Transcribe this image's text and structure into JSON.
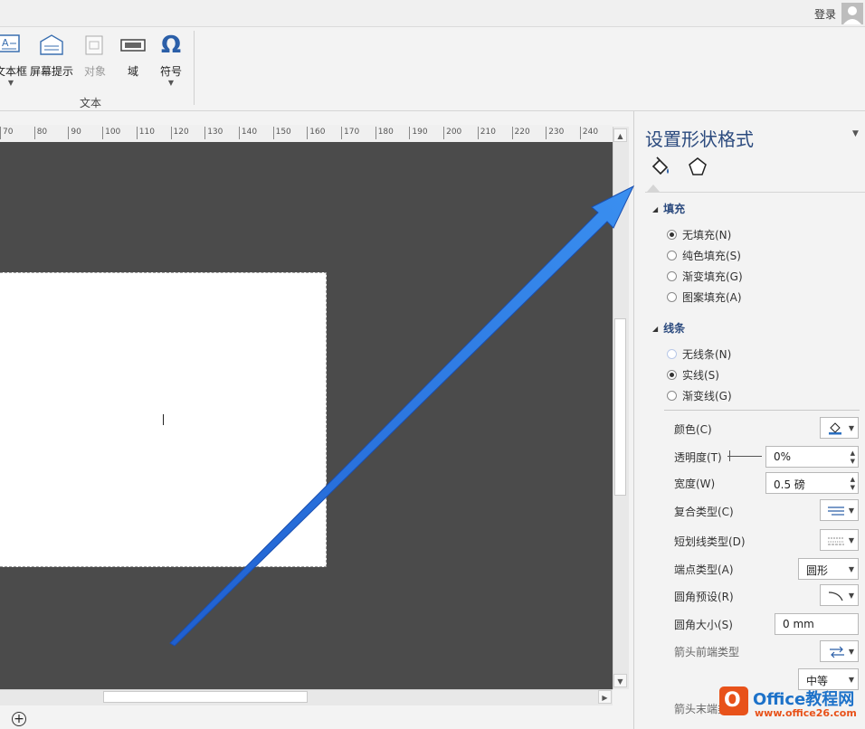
{
  "header": {
    "login_label": "登录"
  },
  "ribbon": {
    "buttons": [
      {
        "label": "文本框"
      },
      {
        "label": "屏幕提示"
      },
      {
        "label": "对象"
      },
      {
        "label": "域"
      },
      {
        "label": "符号",
        "glyph": "Ω"
      }
    ],
    "group_label": "文本"
  },
  "ruler": {
    "ticks": [
      "70",
      "80",
      "90",
      "100",
      "110",
      "120",
      "130",
      "140",
      "150",
      "160",
      "170",
      "180",
      "190",
      "200",
      "210",
      "220",
      "230",
      "240"
    ]
  },
  "panel": {
    "title": "设置形状格式",
    "fill_section": {
      "title": "填充",
      "options": [
        "无填充(N)",
        "纯色填充(S)",
        "渐变填充(G)",
        "图案填充(A)"
      ],
      "selected": 0
    },
    "line_section": {
      "title": "线条",
      "options": [
        "无线条(N)",
        "实线(S)",
        "渐变线(G)"
      ],
      "selected": 1
    },
    "properties": {
      "color_label": "颜色(C)",
      "transparency_label": "透明度(T)",
      "transparency_value": "0%",
      "width_label": "宽度(W)",
      "width_value": "0.5 磅",
      "compound_label": "复合类型(C)",
      "dash_label": "短划线类型(D)",
      "cap_label": "端点类型(A)",
      "cap_value": "圆形",
      "join_label": "圆角预设(R)",
      "size_label": "圆角大小(S)",
      "size_value": "0 mm",
      "arrow_begin_label": "箭头前端类型",
      "arrow_size_value": "中等",
      "arrow_end_label": "箭头末端类型"
    }
  },
  "watermark": {
    "brand": "Office教程网",
    "url": "www.office26.com"
  },
  "colors": {
    "accent": "#2b4a7e",
    "canvas": "#4b4b4b",
    "arrow": "#2a78e8"
  }
}
